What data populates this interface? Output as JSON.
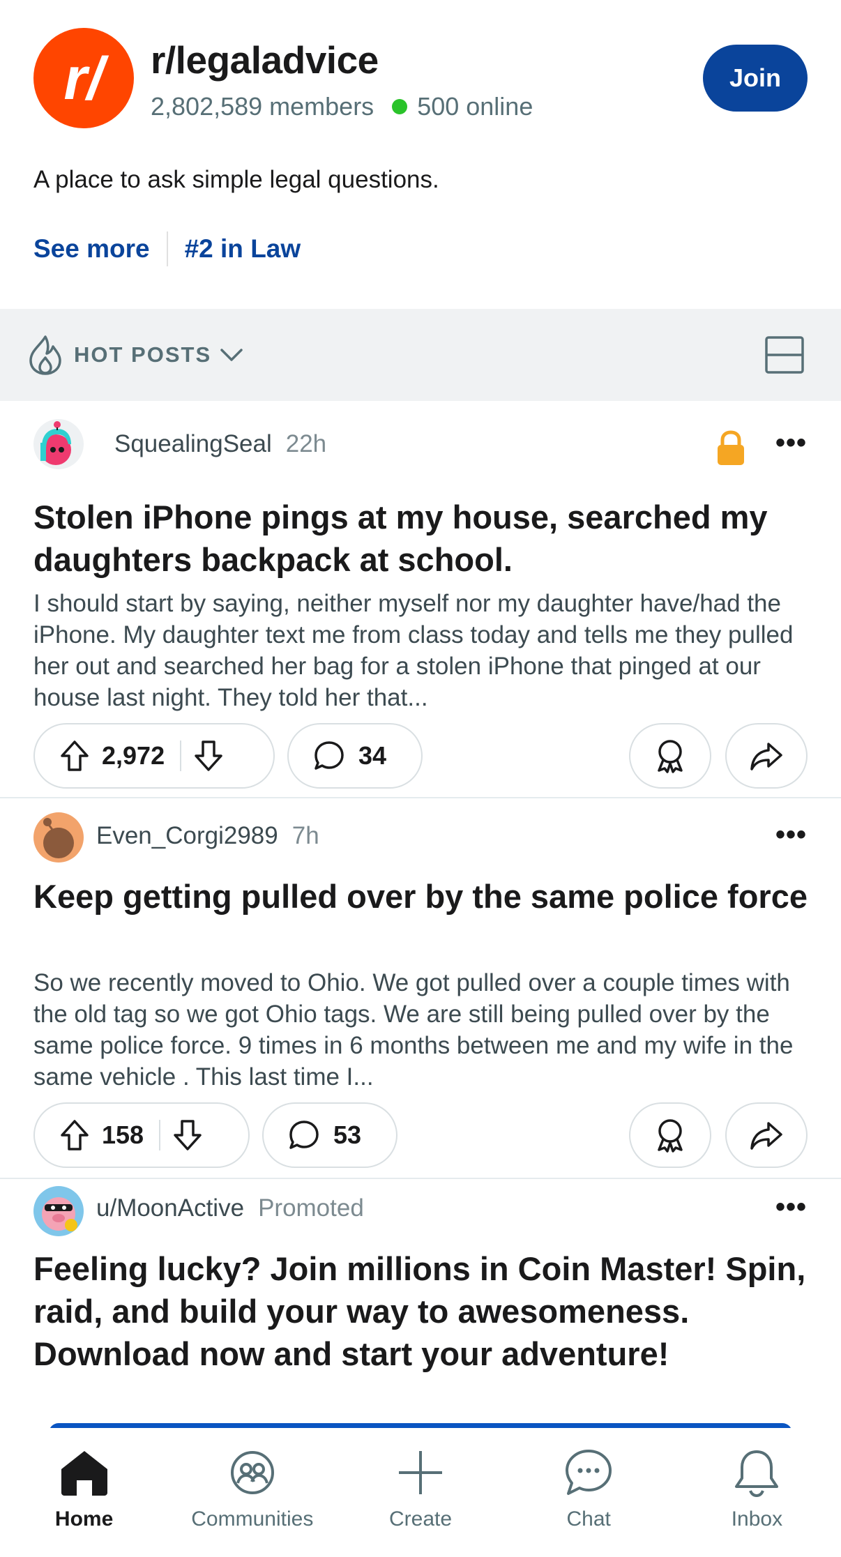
{
  "community": {
    "name": "r/legaladvice",
    "logo_text": "r/",
    "members": "2,802,589 members",
    "online": "500 online",
    "description": "A place to ask simple legal questions.",
    "join_label": "Join",
    "see_more_label": "See more",
    "rank_label": "#2 in Law",
    "brand_color": "#ff4500",
    "join_color": "#0a449b"
  },
  "sort": {
    "label": "HOT POSTS",
    "icon": "flame-icon"
  },
  "posts": [
    {
      "author": "SquealingSeal",
      "time": "22h",
      "locked": true,
      "title": "Stolen iPhone pings at my house, searched my daughters backpack at school.",
      "body": "I should start by saying, neither myself nor my daughter have/had the iPhone. My daughter text me from class today and tells me they pulled her out and searched her bag for a stolen iPhone that pinged at our house last night. They told her that...",
      "upvotes": "2,972",
      "comments": "34"
    },
    {
      "author": "Even_Corgi2989",
      "time": "7h",
      "locked": false,
      "title": "Keep getting pulled over by the same police force",
      "body": "So we recently moved to Ohio. We got pulled over a couple times with the old tag so we got Ohio tags. We are still being pulled over by the same police force. 9 times in 6 months between me and my wife in the same vehicle . This last time I...",
      "upvotes": "158",
      "comments": "53"
    }
  ],
  "ad": {
    "author": "u/MoonActive",
    "tag": "Promoted",
    "title": "Feeling lucky? Join millions in Coin Master! Spin, raid, and build your way to awesomeness. Download now and start your adventure!"
  },
  "nav": {
    "home": "Home",
    "communities": "Communities",
    "create": "Create",
    "chat": "Chat",
    "inbox": "Inbox"
  },
  "more_label": "•••"
}
